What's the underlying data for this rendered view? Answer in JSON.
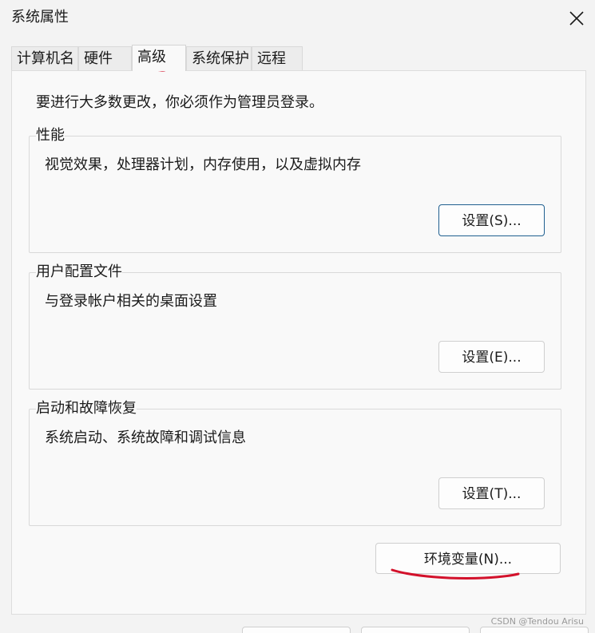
{
  "window": {
    "title": "系统属性"
  },
  "tabs": [
    {
      "label": "计算机名",
      "active": false
    },
    {
      "label": "硬件",
      "active": false
    },
    {
      "label": "高级",
      "active": true
    },
    {
      "label": "系统保护",
      "active": false
    },
    {
      "label": "远程",
      "active": false
    }
  ],
  "advanced": {
    "intro": "要进行大多数更改，你必须作为管理员登录。",
    "performance": {
      "title": "性能",
      "description": "视觉效果，处理器计划，内存使用，以及虚拟内存",
      "button": "设置(S)..."
    },
    "user_profiles": {
      "title": "用户配置文件",
      "description": "与登录帐户相关的桌面设置",
      "button": "设置(E)..."
    },
    "startup_recovery": {
      "title": "启动和故障恢复",
      "description": "系统启动、系统故障和调试信息",
      "button": "设置(T)..."
    },
    "env_button": "环境变量(N)..."
  },
  "icons": {
    "close": "close-icon"
  },
  "colors": {
    "window_bg": "#f3f3f3",
    "panel_bg": "#f9f9f9",
    "default_button_border": "#1f5f8f",
    "annotation": "#d3112b"
  },
  "watermark": "CSDN @Tendou Arisu"
}
